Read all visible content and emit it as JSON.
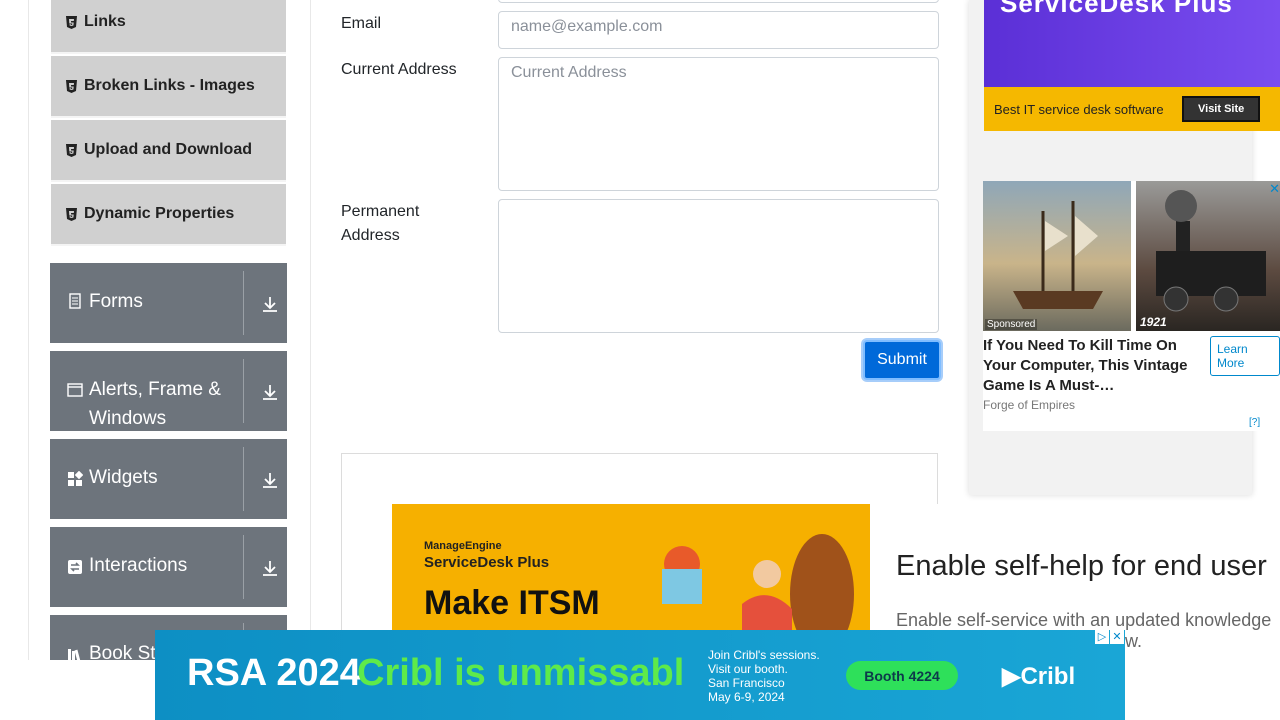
{
  "sidebar": {
    "sub_items": [
      "Links",
      "Broken Links - Images",
      "Upload and Download",
      "Dynamic Properties"
    ],
    "groups": [
      {
        "label": "Forms",
        "icon": "document-icon"
      },
      {
        "label": "Alerts, Frame & Windows",
        "icon": "window-icon"
      },
      {
        "label": "Widgets",
        "icon": "widgets-icon"
      },
      {
        "label": "Interactions",
        "icon": "interactions-icon"
      },
      {
        "label": "Book St",
        "icon": "books-icon"
      }
    ]
  },
  "form": {
    "email_label": "Email",
    "email_placeholder": "name@example.com",
    "current_address_label": "Current Address",
    "current_address_placeholder": "Current Address",
    "permanent_address_label_1": "Permanent",
    "permanent_address_label_2": "Address",
    "submit_label": "Submit"
  },
  "ads": {
    "top_title": "ServiceDesk Plus",
    "top_bar_text": "Best IT service desk software",
    "top_visit": "Visit Site",
    "sponsored_tag": "Sponsored",
    "sponsored_year": "1921",
    "sponsored_headline": "If You Need To Kill Time On Your Computer, This Vintage Game Is A Must-…",
    "sponsored_source": "Forge of Empires",
    "sponsored_cta": "Learn More",
    "sponsored_help": "[?]",
    "mid_brand_1": "ManageEngine",
    "mid_brand_2": "ServiceDesk Plus",
    "mid_tagline": "Make ITSM",
    "mid_heading": "Enable self-help for end user",
    "mid_sub_1": "Enable self-service with an updated knowledge",
    "mid_sub_2": "e how.",
    "bottom_left": "RSA 2024",
    "bottom_green": "Cribl is unmissabl",
    "bottom_info_1": "Join Cribl's sessions.",
    "bottom_info_2": "Visit our booth.",
    "bottom_info_3": "San Francisco",
    "bottom_info_4": "May 6-9, 2024",
    "bottom_booth": "Booth 4224",
    "bottom_logo": "Cribl"
  },
  "colors": {
    "submit": "#0069d9",
    "group_bg": "#6d747c",
    "subitem_bg": "#d0d0d0",
    "ad_yellow": "#f5b800"
  }
}
